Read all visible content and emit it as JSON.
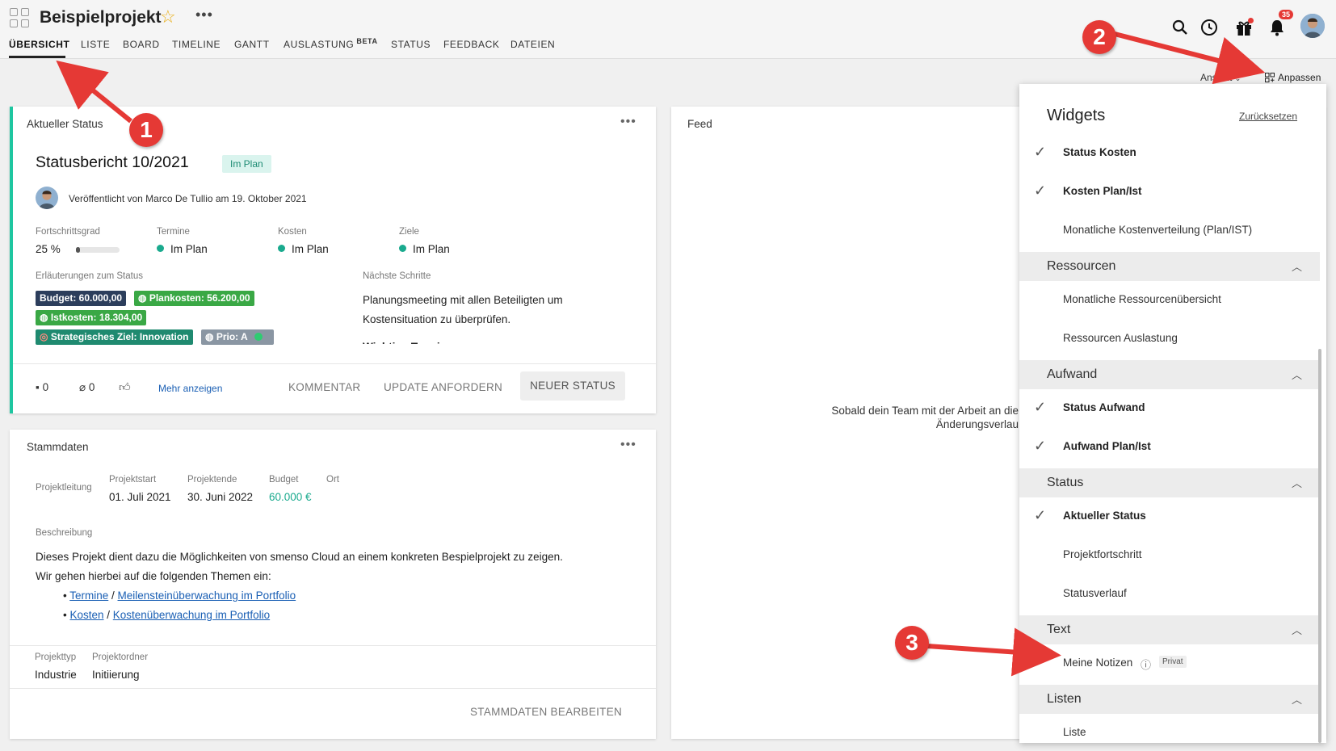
{
  "header": {
    "project_title": "Beispielprojekt",
    "tabs": [
      {
        "label": "ÜBERSICHT"
      },
      {
        "label": "LISTE"
      },
      {
        "label": "BOARD"
      },
      {
        "label": "TIMELINE"
      },
      {
        "label": "GANTT"
      },
      {
        "label": "AUSLASTUNG",
        "badge": "BETA"
      },
      {
        "label": "STATUS"
      },
      {
        "label": "FEEDBACK"
      },
      {
        "label": "DATEIEN"
      }
    ],
    "notification_count": "35",
    "icons": [
      "apps-grid-icon",
      "star-icon",
      "more-icon",
      "search-icon",
      "clock-icon",
      "gift-icon",
      "bell-icon",
      "avatar"
    ],
    "ansicht_label": "Ansicht",
    "anpassen_label": "Anpassen"
  },
  "status_card": {
    "title": "Aktueller Status",
    "report_title": "Statusbericht 10/2021",
    "report_badge": "Im Plan",
    "published": "Veröffentlicht von Marco De Tullio am 19. Oktober 2021",
    "metrics": [
      {
        "label": "Fortschrittsgrad",
        "value": "25 %"
      },
      {
        "label": "Termine",
        "value": "Im Plan"
      },
      {
        "label": "Kosten",
        "value": "Im Plan"
      },
      {
        "label": "Ziele",
        "value": "Im Plan"
      }
    ],
    "progress": 0.25,
    "explain_label": "Erläuterungen zum Status",
    "chips": [
      {
        "text": "Budget: 60.000,00",
        "color": "#2c3e5c"
      },
      {
        "text": "Plankosten: 56.200,00",
        "color": "#3aa845"
      },
      {
        "text": "Istkosten: 18.304,00",
        "color": "#3aa845"
      },
      {
        "text": "Strategisches Ziel: Innovation",
        "color": "#1f8a70"
      },
      {
        "text": "Prio: A",
        "color": "#8a96a3"
      }
    ],
    "next_steps_label": "Nächste Schritte",
    "next_steps_text_1": "Planungsmeeting mit allen Beteiligten um",
    "next_steps_text_2": "Kostensituation zu überprüfen.",
    "next_steps_text_3": "Wichtige Termine",
    "comment_count": "0",
    "attachment_count": "0",
    "more_link": "Mehr anzeigen",
    "btn_comment": "KOMMENTAR",
    "btn_update": "UPDATE ANFORDERN",
    "btn_new": "NEUER STATUS"
  },
  "master_card": {
    "title": "Stammdaten",
    "fields": [
      {
        "label": "Projektleitung",
        "value": ""
      },
      {
        "label": "Projektstart",
        "value": "01. Juli 2021"
      },
      {
        "label": "Projektende",
        "value": "30. Juni 2022"
      },
      {
        "label": "Budget",
        "value": "60.000 €"
      },
      {
        "label": "Ort",
        "value": ""
      }
    ],
    "description_label": "Beschreibung",
    "description_1": "Dieses Projekt dient dazu die Möglichkeiten von smenso Cloud an einem konkreten Bespielprojekt zu zeigen.",
    "description_2": "Wir gehen hierbei auf die folgenden Themen ein:",
    "bullets": [
      {
        "a": "Termine",
        "sep": " / ",
        "b": "Meilensteinüberwachung im Portfolio"
      },
      {
        "a": "Kosten",
        "sep": " / ",
        "b": "Kostenüberwachung im Portfolio"
      }
    ],
    "type_label": "Projekttyp",
    "type_value": "Industrie",
    "folder_label": "Projektordner",
    "folder_value": "Initiierung",
    "edit_btn": "STAMMDATEN BEARBEITEN"
  },
  "feed_card": {
    "title": "Feed",
    "empty_1": "Sobald dein Team mit der Arbeit an die",
    "empty_2": "Änderungsverlau"
  },
  "widgets": {
    "title": "Widgets",
    "reset": "Zurücksetzen",
    "top_items": [
      {
        "label": "Status Kosten",
        "checked": true
      },
      {
        "label": "Kosten Plan/Ist",
        "checked": true
      },
      {
        "label": "Monatliche Kostenverteilung (Plan/IST)",
        "checked": false
      }
    ],
    "sections": [
      {
        "title": "Ressourcen",
        "items": [
          {
            "label": "Monatliche Ressourcenübersicht",
            "checked": false
          },
          {
            "label": "Ressourcen Auslastung",
            "checked": false
          }
        ]
      },
      {
        "title": "Aufwand",
        "items": [
          {
            "label": "Status Aufwand",
            "checked": true
          },
          {
            "label": "Aufwand Plan/Ist",
            "checked": true
          }
        ]
      },
      {
        "title": "Status",
        "items": [
          {
            "label": "Aktueller Status",
            "checked": true
          },
          {
            "label": "Projektfortschritt",
            "checked": false
          },
          {
            "label": "Statusverlauf",
            "checked": false
          }
        ]
      },
      {
        "title": "Text",
        "items": [
          {
            "label": "Meine Notizen",
            "checked": false,
            "tag": "Privat"
          }
        ]
      },
      {
        "title": "Listen",
        "items": [
          {
            "label": "Liste",
            "checked": false
          }
        ]
      }
    ]
  },
  "annotations": [
    "1",
    "2",
    "3"
  ]
}
